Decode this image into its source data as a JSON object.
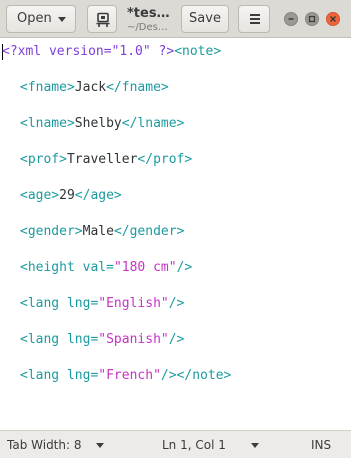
{
  "header": {
    "open_label": "Open",
    "title": "*tes…",
    "subtitle": "~/Des…",
    "save_label": "Save"
  },
  "editor": {
    "line1": {
      "pi": "<?xml version=\"1.0\" ?>",
      "tag": "<note>"
    },
    "line2": {
      "open": "<fname>",
      "text": "Jack",
      "close": "</fname>"
    },
    "line3": {
      "open": "<lname>",
      "text": "Shelby",
      "close": "</lname>"
    },
    "line4": {
      "open": "<prof>",
      "text": "Traveller",
      "close": "</prof>"
    },
    "line5": {
      "open": "<age>",
      "text": "29",
      "close": "</age>"
    },
    "line6": {
      "open": "<gender>",
      "text": "Male",
      "close": "</gender>"
    },
    "line7": {
      "tag_start": "<height",
      "attr": " val=",
      "value": "\"180 cm\"",
      "tag_end": "/>"
    },
    "line8": {
      "tag_start": "<lang",
      "attr": " lng=",
      "value": "\"English\"",
      "tag_end": "/>"
    },
    "line9": {
      "tag_start": "<lang",
      "attr": " lng=",
      "value": "\"Spanish\"",
      "tag_end": "/>"
    },
    "line10": {
      "tag_start": "<lang",
      "attr": " lng=",
      "value": "\"French\"",
      "tag_end": "/></note>"
    }
  },
  "status": {
    "tab_width": "Tab Width: 8",
    "position": "Ln 1, Col 1",
    "mode": "INS"
  },
  "colors": {
    "tag": "#1b9ba0",
    "string": "#c533c5",
    "processing_instruction": "#7f3fd9",
    "close_button": "#f0643a"
  },
  "icons": [
    "chevron-down-icon",
    "pin-icon",
    "hamburger-menu-icon",
    "minimize-icon",
    "maximize-icon",
    "close-icon"
  ]
}
